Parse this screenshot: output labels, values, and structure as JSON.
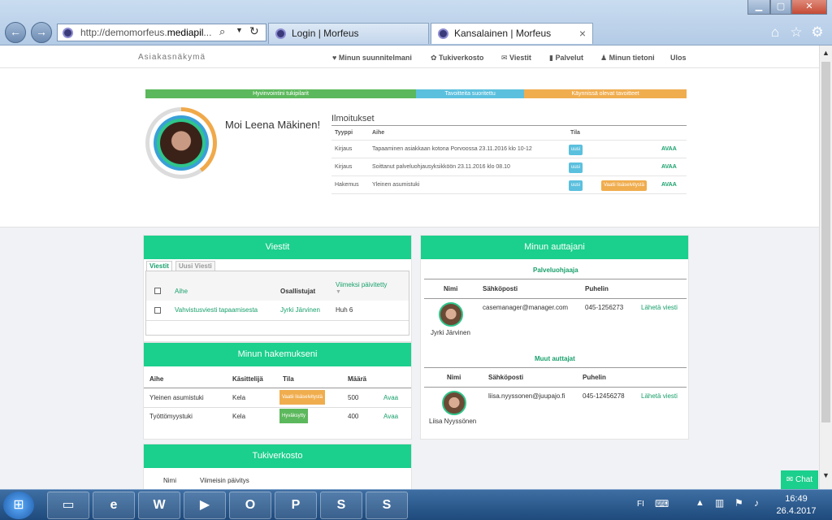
{
  "browser": {
    "url_prefix": "http://demomorfeus.",
    "url_domain": "mediapil",
    "url_suffix": "...",
    "tabs": [
      {
        "label": "Login | Morfeus"
      },
      {
        "label": "Kansalainen | Morfeus",
        "close": "×"
      }
    ]
  },
  "header": {
    "brand": "Asiakasnäkymä",
    "nav": [
      "Minun suunnitelmani",
      "Tukiverkosto",
      "Viestit",
      "Palvelut",
      "Minun tietoni",
      "Ulos"
    ]
  },
  "progress": {
    "segments": [
      {
        "label": "Hyvinvointini tukipilarit",
        "color": "#5cb85c",
        "fraction": 0.5
      },
      {
        "label": "Tavoitteita suoritettu",
        "color": "#5bc0de",
        "fraction": 0.2
      },
      {
        "label": "Käynnissä olevat tavoitteet",
        "color": "#f0ad4e",
        "fraction": 0.3
      }
    ]
  },
  "profile": {
    "greeting": "Moi Leena Mäkinen!"
  },
  "notifications": {
    "title": "Ilmoitukset",
    "headers": {
      "type": "Tyyppi",
      "topic": "Aihe",
      "status": "Tila"
    },
    "rows": [
      {
        "type": "Kirjaus",
        "topic": "Tapaaminen asiakkaan kotona Porvoossa 23.11.2016 klo 10-12",
        "status": "uusi",
        "extra": "",
        "action": "AVAA"
      },
      {
        "type": "Kirjaus",
        "topic": "Soittanut palveluohjausyksikköön 23.11.2016 klo 08.10",
        "status": "uusi",
        "extra": "",
        "action": "AVAA"
      },
      {
        "type": "Hakemus",
        "topic": "Yleinen asumistuki",
        "status": "uusi",
        "extra": "Vaatii lisäselvitystä",
        "action": "AVAA"
      }
    ]
  },
  "messages": {
    "title": "Viestit",
    "tabs": [
      "Viestit",
      "Uusi Viesti"
    ],
    "headers": {
      "topic": "Aihe",
      "participants": "Osallistujat",
      "updated": "Viimeksi päivitetty"
    },
    "rows": [
      {
        "topic": "Vahvistusviesti tapaamisesta",
        "participants": "Jyrki Järvinen",
        "updated": "Huh 6"
      }
    ]
  },
  "applications": {
    "title": "Minun hakemukseni",
    "headers": {
      "topic": "Aihe",
      "handler": "Käsittelijä",
      "status": "Tila",
      "amount": "Määrä"
    },
    "rows": [
      {
        "topic": "Yleinen asumistuki",
        "handler": "Kela",
        "status": "Vaatii lisäselvitystä",
        "amount": "500",
        "action": "Avaa"
      },
      {
        "topic": "Työttömyystuki",
        "handler": "Kela",
        "status": "Hyväksytty",
        "amount": "400",
        "action": "Avaa"
      }
    ]
  },
  "support": {
    "title": "Tukiverkosto",
    "headers": {
      "name": "Nimi",
      "recent": "Viimeisin päivitys"
    }
  },
  "helpers": {
    "title": "Minun auttajani",
    "headers": {
      "name": "Nimi",
      "email": "Sähköposti",
      "phone": "Puhelin"
    },
    "groups": [
      {
        "title": "Palveluohjaaja",
        "name": "Jyrki Järvinen",
        "email": "casemanager@manager.com",
        "phone": "045-1256273",
        "action": "Lähetä viesti"
      },
      {
        "title": "Muut auttajat",
        "name": "Liisa Nyyssönen",
        "email": "liisa.nyyssonen@juupajo.fi",
        "phone": "045-12456278",
        "action": "Lähetä viesti"
      }
    ]
  },
  "chat": {
    "label": "Chat"
  },
  "taskbar": {
    "lang": "FI",
    "time": "16:49",
    "date": "26.4.2017",
    "apps": [
      "folder-icon",
      "ie-icon",
      "word-icon",
      "media-icon",
      "outlook-icon",
      "powerpoint-icon",
      "skype-icon",
      "skype-business-icon"
    ]
  }
}
